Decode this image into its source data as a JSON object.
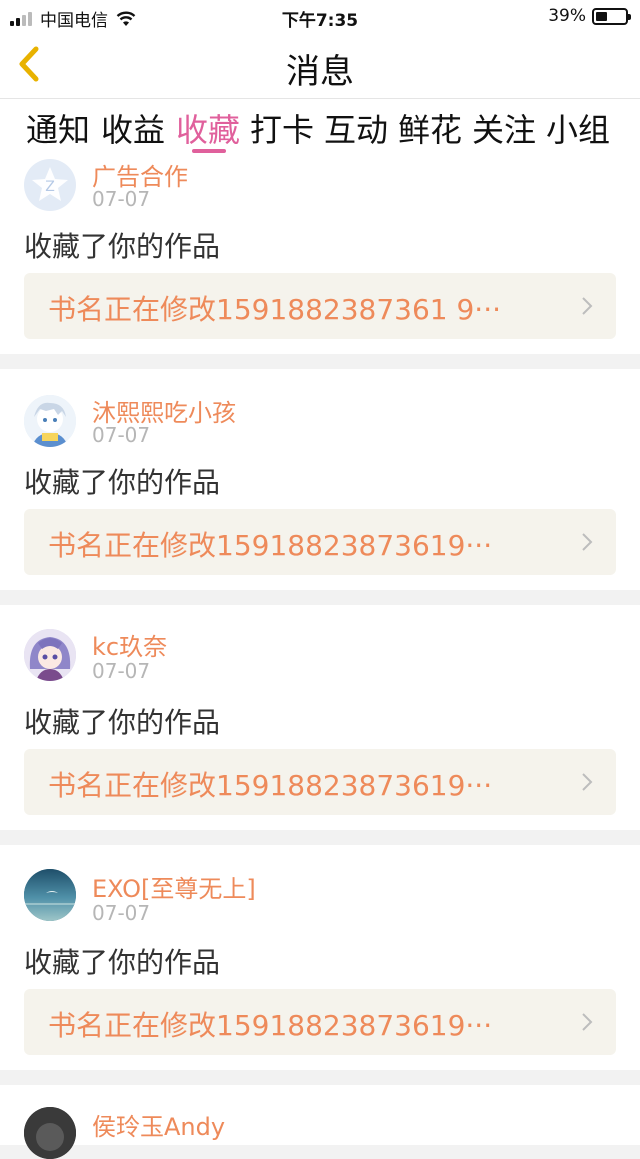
{
  "status_bar": {
    "carrier": "中国电信",
    "time": "下午7:35",
    "battery": "39%",
    "battery_level": 0.39
  },
  "header": {
    "title": "消息"
  },
  "tabs": [
    {
      "label": "通知"
    },
    {
      "label": "收益"
    },
    {
      "label": "收藏",
      "active": true
    },
    {
      "label": "打卡"
    },
    {
      "label": "互动"
    },
    {
      "label": "鲜花"
    },
    {
      "label": "关注"
    },
    {
      "label": "小组"
    }
  ],
  "colors": {
    "accent": "#e0609c",
    "name": "#ee8a5a",
    "work_bg": "#f5f3ec"
  },
  "items": [
    {
      "user": "广告合作",
      "date": "07-07",
      "action": "收藏了你的作品",
      "work_title": "书名正在修改1591882387361 9···"
    },
    {
      "user": "沐熙熙吃小孩",
      "date": "07-07",
      "action": "收藏了你的作品",
      "work_title": "书名正在修改15918823873619···"
    },
    {
      "user": "kc玖奈",
      "date": "07-07",
      "action": "收藏了你的作品",
      "work_title": "书名正在修改15918823873619···"
    },
    {
      "user": "EXO[至尊无上]",
      "date": "07-07",
      "action": "收藏了你的作品",
      "work_title": "书名正在修改15918823873619···"
    },
    {
      "user": "侯玲玉Andy"
    }
  ]
}
